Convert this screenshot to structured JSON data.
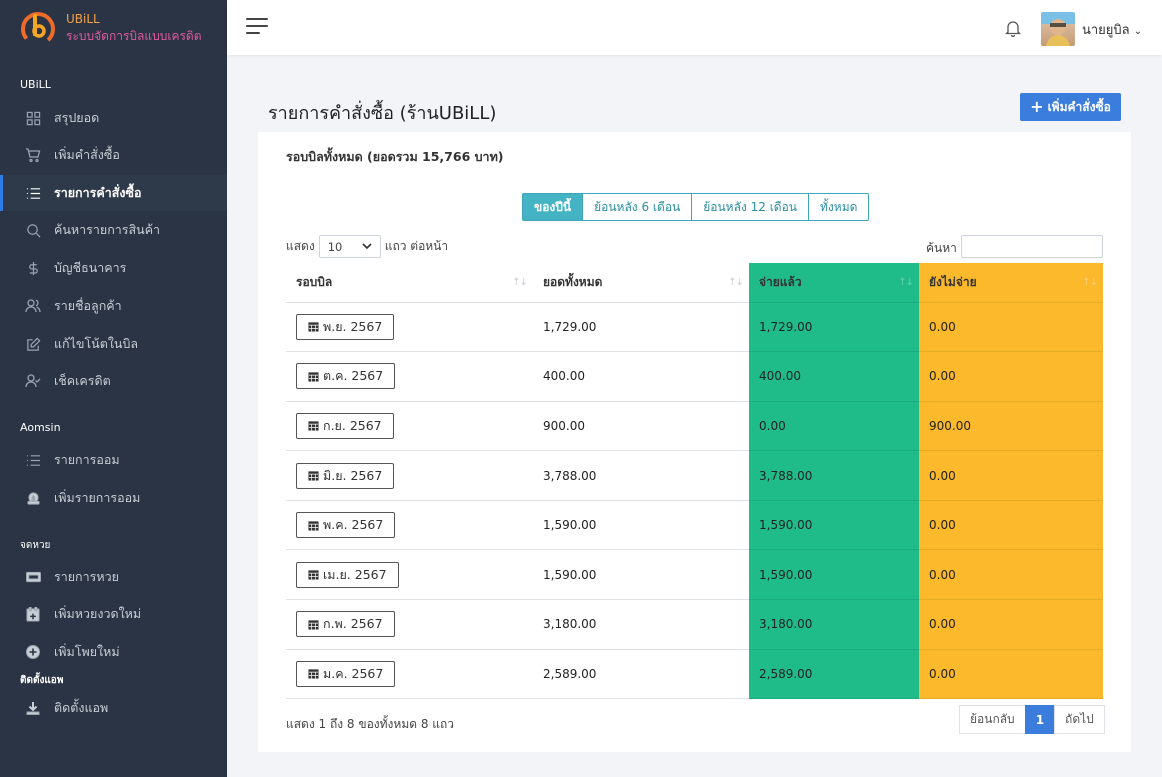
{
  "brand": {
    "name": "UBiLL",
    "subtitle": "ระบบจัดการบิลแบบเครดิต"
  },
  "sidebar": {
    "sections": [
      "UBiLL",
      "Aomsin",
      "จดหวย",
      "ติดตั้งแอพ"
    ],
    "items": [
      {
        "label": "สรุปยอด",
        "icon": "grid-icon"
      },
      {
        "label": "เพิ่มคำสั่งซื้อ",
        "icon": "cart-icon"
      },
      {
        "label": "รายการคำสั่งซื้อ",
        "icon": "list-icon",
        "active": true
      },
      {
        "label": "ค้นหารายการสินค้า",
        "icon": "search-icon"
      },
      {
        "label": "บัญชีธนาคาร",
        "icon": "dollar-icon"
      },
      {
        "label": "รายชื่อลูกค้า",
        "icon": "users-icon"
      },
      {
        "label": "แก้ไขโน้ตในบิล",
        "icon": "edit-icon"
      },
      {
        "label": "เช็คเครดิต",
        "icon": "user-check-icon"
      },
      {
        "label": "รายการออม",
        "icon": "list-icon"
      },
      {
        "label": "เพิ่มรายการออม",
        "icon": "piggy-icon"
      },
      {
        "label": "รายการหวย",
        "icon": "ticket-icon"
      },
      {
        "label": "เพิ่มหวยงวดใหม่",
        "icon": "calendar-plus-icon"
      },
      {
        "label": "เพิ่มโพยใหม่",
        "icon": "plus-circle-icon"
      },
      {
        "label": "ติดตั้งแอพ",
        "icon": "download-icon"
      }
    ]
  },
  "topbar": {
    "username": "นายยูบิล"
  },
  "page": {
    "title": "รายการคำสั่งซื้อ (ร้านUBiLL)",
    "add_button": "เพิ่มคำสั่งซื้อ"
  },
  "card": {
    "header": "รอบบิลทั้งหมด (ยอดรวม 15,766 บาท)"
  },
  "filters": [
    "ของปีนี้",
    "ย้อนหลัง 6 เดือน",
    "ย้อนหลัง 12 เดือน",
    "ทั้งหมด"
  ],
  "length": {
    "prefix": "แสดง",
    "value": "10",
    "suffix": "แถว ต่อหน้า"
  },
  "search": {
    "label": "ค้นหา",
    "value": ""
  },
  "table": {
    "headers": [
      "รอบบิล",
      "ยอดทั้งหมด",
      "จ่ายแล้ว",
      "ยังไม่จ่าย"
    ],
    "rows": [
      {
        "period": "พ.ย. 2567",
        "total": "1,729.00",
        "paid": "1,729.00",
        "unpaid": "0.00"
      },
      {
        "period": "ต.ค. 2567",
        "total": "400.00",
        "paid": "400.00",
        "unpaid": "0.00"
      },
      {
        "period": "ก.ย. 2567",
        "total": "900.00",
        "paid": "0.00",
        "unpaid": "900.00"
      },
      {
        "period": "มิ.ย. 2567",
        "total": "3,788.00",
        "paid": "3,788.00",
        "unpaid": "0.00"
      },
      {
        "period": "พ.ค. 2567",
        "total": "1,590.00",
        "paid": "1,590.00",
        "unpaid": "0.00"
      },
      {
        "period": "เม.ย. 2567",
        "total": "1,590.00",
        "paid": "1,590.00",
        "unpaid": "0.00"
      },
      {
        "period": "ก.พ. 2567",
        "total": "3,180.00",
        "paid": "3,180.00",
        "unpaid": "0.00"
      },
      {
        "period": "ม.ค. 2567",
        "total": "2,589.00",
        "paid": "2,589.00",
        "unpaid": "0.00"
      }
    ]
  },
  "footer": {
    "info": "แสดง 1 ถึง 8 ของทั้งหมด 8 แถว",
    "prev": "ย้อนกลับ",
    "page": "1",
    "next": "ถัดไป"
  },
  "colors": {
    "paid": "#1fbb89",
    "unpaid": "#fbb92b",
    "primary": "#3b7ddd",
    "sidebar": "#2a3444"
  }
}
